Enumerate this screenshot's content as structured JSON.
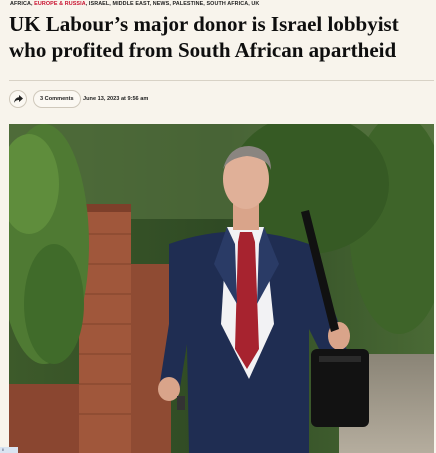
{
  "categories": [
    {
      "label": "AFRICA",
      "highlight": false
    },
    {
      "label": "EUROPE & RUSSIA",
      "highlight": true
    },
    {
      "label": "ISRAEL",
      "highlight": false
    },
    {
      "label": "MIDDLE EAST",
      "highlight": false
    },
    {
      "label": "NEWS",
      "highlight": false
    },
    {
      "label": "PALESTINE",
      "highlight": false
    },
    {
      "label": "SOUTH AFRICA",
      "highlight": false
    },
    {
      "label": "UK",
      "highlight": false
    }
  ],
  "article": {
    "title": "UK Labour’s major donor is Israel lobbyist who profited from South African apartheid",
    "comments_label": "3 Comments",
    "date": "June 13, 2023 at 9:56 am"
  },
  "corner_tag": "l/",
  "icons": {
    "share": "share-icon"
  },
  "colors": {
    "accent": "#c8102e",
    "background": "#f8f4ec"
  }
}
